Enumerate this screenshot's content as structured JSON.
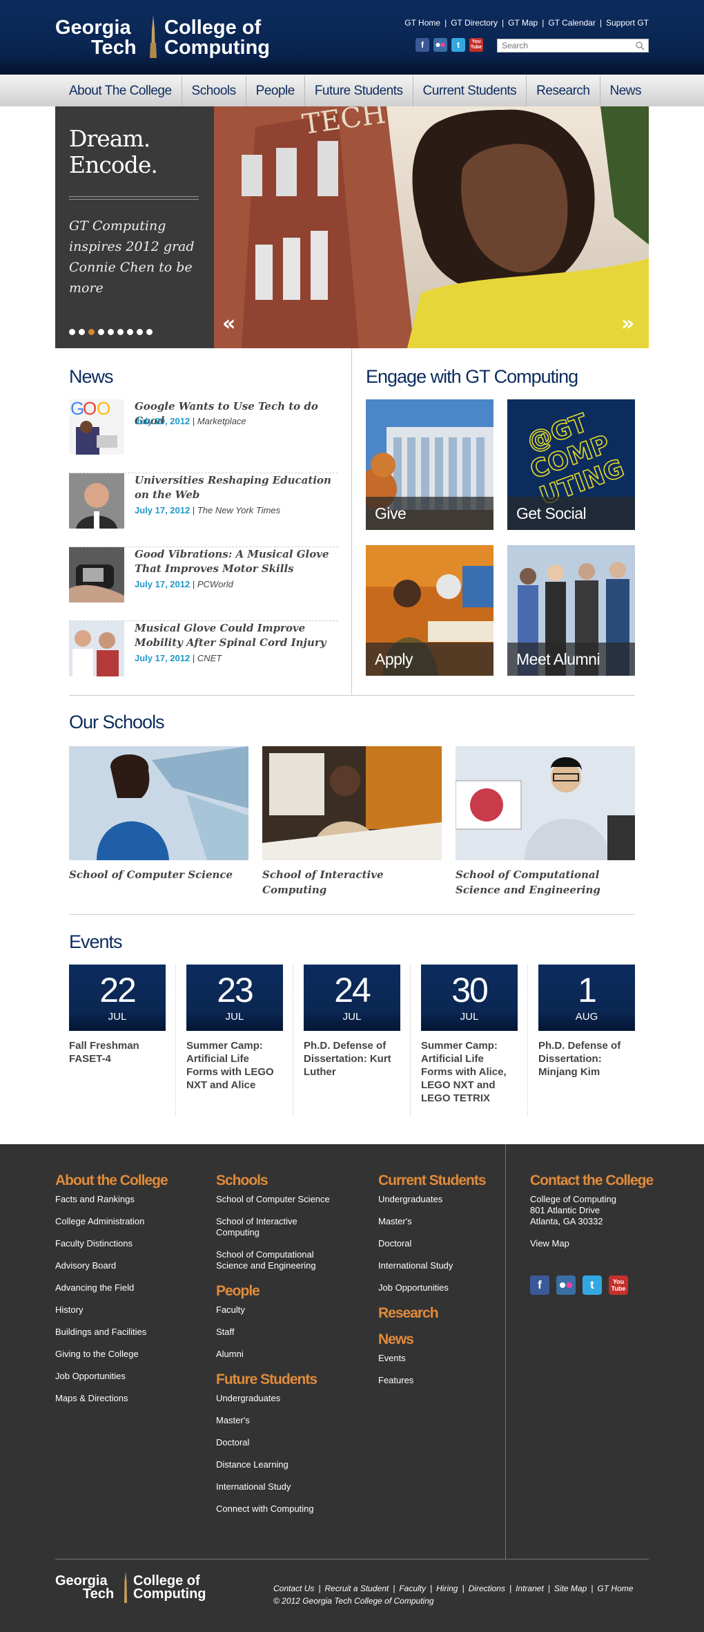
{
  "header": {
    "logo_gt": [
      "Georgia",
      "Tech"
    ],
    "logo_coc": [
      "College of",
      "Computing"
    ],
    "top_links": [
      "GT Home",
      "GT Directory",
      "GT Map",
      "GT Calendar",
      "Support GT"
    ],
    "search_placeholder": "Search",
    "social_icons": [
      "facebook-icon",
      "flickr-icon",
      "twitter-icon",
      "youtube-icon"
    ]
  },
  "nav": [
    "About The College",
    "Schools",
    "People",
    "Future Students",
    "Current Students",
    "Research",
    "News"
  ],
  "hero": {
    "title": [
      "Dream.",
      "Encode."
    ],
    "subtitle": "GT Computing inspires 2012 grad Connie Chen to be more",
    "slide_count": 9,
    "active_slide": 3
  },
  "news": {
    "title": "News",
    "items": [
      {
        "headline": "Google Wants to Use Tech to do Good",
        "date": "July 20, 2012",
        "source": "Marketplace"
      },
      {
        "headline": "Universities Reshaping Education on the Web",
        "date": "July 17, 2012",
        "source": "The New York Times"
      },
      {
        "headline": "Good Vibrations: A Musical Glove That Improves Motor Skills",
        "date": "July 17, 2012",
        "source": "PCWorld"
      },
      {
        "headline": "Musical Glove Could Improve Mobility After Spinal Cord Injury",
        "date": "July 17, 2012",
        "source": "CNET"
      }
    ]
  },
  "engage": {
    "title": "Engage with GT Computing",
    "tiles": [
      "Give",
      "Get Social",
      "Apply",
      "Meet Alumni"
    ],
    "social_tile_text": [
      "@GT",
      "COMP",
      "UTING"
    ]
  },
  "schools": {
    "title": "Our Schools",
    "items": [
      "School of Computer Science",
      "School of Interactive Computing",
      "School of Computational Science and Engineering"
    ]
  },
  "events": {
    "title": "Events",
    "items": [
      {
        "day": "22",
        "month": "JUL",
        "title": "Fall Freshman FASET-4"
      },
      {
        "day": "23",
        "month": "JUL",
        "title": "Summer Camp: Artificial Life Forms with LEGO NXT and Alice"
      },
      {
        "day": "24",
        "month": "JUL",
        "title": "Ph.D. Defense of Dissertation: Kurt Luther"
      },
      {
        "day": "30",
        "month": "JUL",
        "title": "Summer Camp: Artificial Life Forms with Alice, LEGO NXT and LEGO TETRIX"
      },
      {
        "day": "1",
        "month": "AUG",
        "title": "Ph.D. Defense of Dissertation: Minjang Kim"
      }
    ]
  },
  "footer": {
    "about": {
      "title": "About the College",
      "links": [
        "Facts and Rankings",
        "College Administration",
        "Faculty Distinctions",
        "Advisory Board",
        "Advancing the Field",
        "History",
        "Buildings and Facilities",
        "Giving to the College",
        "Job Opportunities",
        "Maps & Directions"
      ]
    },
    "schools": {
      "title": "Schools",
      "links": [
        "School of Computer Science",
        "School of Interactive Computing",
        "School of Computational Science and Engineering"
      ]
    },
    "people": {
      "title": "People",
      "links": [
        "Faculty",
        "Staff",
        "Alumni"
      ]
    },
    "future": {
      "title": "Future Students",
      "links": [
        "Undergraduates",
        "Master's",
        "Doctoral",
        "Distance Learning",
        "International Study",
        "Connect with Computing"
      ]
    },
    "current": {
      "title": "Current Students",
      "links": [
        "Undergraduates",
        "Master's",
        "Doctoral",
        "International Study",
        "Job Opportunities"
      ]
    },
    "research": {
      "title": "Research"
    },
    "news": {
      "title": "News",
      "links": [
        "Events",
        "Features"
      ]
    },
    "contact": {
      "title": "Contact the College",
      "address": [
        "College of Computing",
        "801 Atlantic Drive",
        "Atlanta, GA 30332"
      ],
      "map_link": "View Map"
    },
    "bottom_links": [
      "Contact Us",
      "Recruit a Student",
      "Faculty",
      "Hiring",
      "Directions",
      "Intranet",
      "Site Map",
      "GT Home"
    ],
    "copyright": "© 2012 Georgia Tech College of Computing"
  },
  "colors": {
    "navy": "#0c2c5e",
    "orange": "#e08b3a",
    "date_blue": "#1f97c8",
    "footer_bg": "#333333"
  }
}
